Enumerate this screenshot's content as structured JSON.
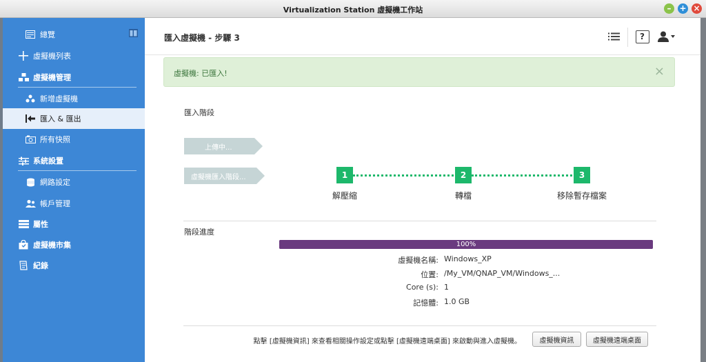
{
  "window": {
    "title": "Virtualization Station 虛擬機工作站"
  },
  "colors": {
    "sidebar": "#3d87d6",
    "accent_green": "#1db86b",
    "progress": "#6a3a7f",
    "alert_bg": "#dff0d8"
  },
  "sidebar": {
    "items": [
      {
        "label": "總覽",
        "icon": "overview-icon"
      },
      {
        "label": "虛擬機列表",
        "icon": "plus-icon"
      },
      {
        "label": "虛擬機管理",
        "icon": "vm-manage-icon"
      },
      {
        "label": "新增虛擬機",
        "icon": "vm-add-icon"
      },
      {
        "label": "匯入 & 匯出",
        "icon": "import-export-icon"
      },
      {
        "label": "所有快照",
        "icon": "camera-icon"
      },
      {
        "label": "系統設置",
        "icon": "sliders-icon"
      },
      {
        "label": "網路設定",
        "icon": "network-icon"
      },
      {
        "label": "帳戶管理",
        "icon": "users-icon"
      },
      {
        "label": "屬性",
        "icon": "properties-icon"
      },
      {
        "label": "虛擬機市集",
        "icon": "market-icon"
      },
      {
        "label": "紀錄",
        "icon": "log-icon"
      }
    ]
  },
  "header": {
    "title": "匯入虛擬機 - 步驟 3",
    "help": "?"
  },
  "alert": {
    "message": "虛擬機: 已匯入!",
    "close": "×"
  },
  "import_stage": {
    "label": "匯入階段",
    "steps": [
      "上傳中...",
      "虛擬機匯入階段..."
    ],
    "nodes": [
      {
        "number": "1",
        "label": "解壓縮"
      },
      {
        "number": "2",
        "label": "轉檔"
      },
      {
        "number": "3",
        "label": "移除暫存檔案"
      }
    ]
  },
  "progress": {
    "label": "階段進度",
    "percent": 100,
    "text": "100%"
  },
  "vm_info": {
    "name_label": "虛擬機名稱:",
    "name_value": "Windows_XP",
    "location_label": "位置:",
    "location_value": "/My_VM/QNAP_VM/Windows_...",
    "cores_label": "Core (s):",
    "cores_value": "1",
    "memory_label": "記憶體:",
    "memory_value": "1.0 GB"
  },
  "footer": {
    "text": "點擊 [虛擬機資訊] 來查看相關操作設定或點擊 [虛擬機遠端桌面] 來啟動與進入虛擬機。",
    "info_button": "虛擬機資訊",
    "remote_button": "虛擬機遠端桌面"
  }
}
